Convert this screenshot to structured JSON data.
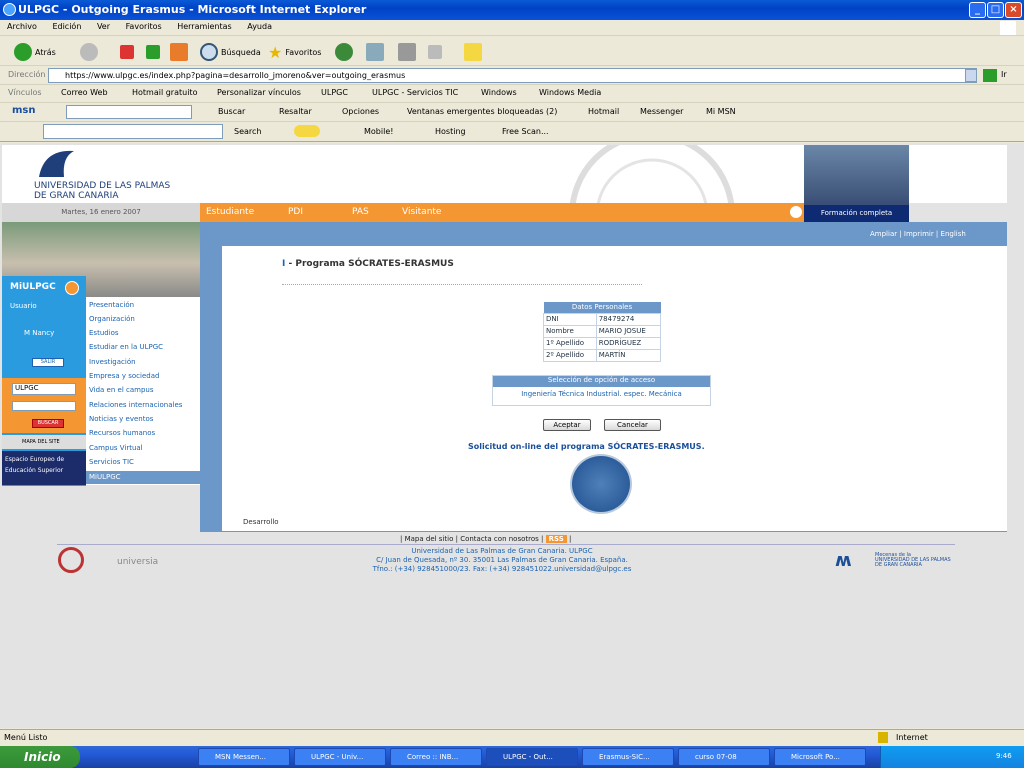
{
  "window": {
    "title": "ULPGC - Outgoing Erasmus - Microsoft Internet Explorer"
  },
  "menu": [
    "Archivo",
    "Edición",
    "Ver",
    "Favoritos",
    "Herramientas",
    "Ayuda"
  ],
  "toolbar": {
    "back": "Atrás",
    "search": "Búsqueda",
    "favorites": "Favoritos"
  },
  "address": {
    "label": "Dirección",
    "url": "https://www.ulpgc.es/index.php?pagina=desarrollo_jmoreno&ver=outgoing_erasmus",
    "go": "Ir"
  },
  "links": {
    "label": "Vínculos",
    "items": [
      "Correo Web",
      "Hotmail gratuito",
      "Personalizar vínculos",
      "ULPGC",
      "ULPGC - Servicios TIC",
      "Windows",
      "Windows Media"
    ]
  },
  "msn": {
    "brand": "msn",
    "search": "Buscar",
    "highlight": "Resaltar",
    "options": "Opciones",
    "popups": "Ventanas emergentes bloqueadas (2)",
    "hotmail": "Hotmail",
    "messenger": "Messenger",
    "mymsn": "Mi MSN"
  },
  "searchbar": {
    "search": "Search",
    "mobile": "Mobile!",
    "hosting": "Hosting",
    "freescan": "Free Scan..."
  },
  "site": {
    "logo_line1": "UNIVERSIDAD DE LAS PALMAS",
    "logo_line2": "DE GRAN CANARIA",
    "date": "Martes, 16 enero 2007",
    "nav": [
      "Estudiante",
      "PDI",
      "PAS",
      "Visitante"
    ],
    "formacion": "Formación completa",
    "toplinks": "Ampliar | Imprimir | English",
    "miulpgc": {
      "title": "MiULPGC",
      "user_label": "Usuario",
      "user": "M Nancy",
      "logout": "SALIR",
      "select": "ULPGC",
      "search_btn": "BUSCAR",
      "map": "MAPA DEL SITE",
      "espacio1": "Espacio Europeo de",
      "espacio2": "Educación Superior"
    },
    "leftmenu": [
      "Presentación",
      "Organización",
      "Estudios",
      "Estudiar en la ULPGC",
      "Investigación",
      "Empresa y sociedad",
      "Vida en el campus",
      "Relaciones internacionales",
      "Noticias y eventos",
      "Recursos humanos",
      "Campus Virtual",
      "Servicios TIC",
      "MiULPGC"
    ]
  },
  "content": {
    "heading_prefix": "I",
    "heading": " - Programa SÓCRATES-ERASMUS",
    "personal": {
      "title": "Datos Personales",
      "rows": [
        [
          "DNI",
          "78479274"
        ],
        [
          "Nombre",
          "MARIO JOSUE"
        ],
        [
          "1º Apellido",
          "RODRÍGUEZ"
        ],
        [
          "2º Apellido",
          "MARTÍN"
        ]
      ]
    },
    "selection": {
      "title": "Selección de opción de acceso",
      "value": "Ingeniería Técnica Industrial. espec. Mecánica"
    },
    "accept": "Aceptar",
    "cancel": "Cancelar",
    "solicitud": "Solicitud on-line del programa SÓCRATES-ERASMUS.",
    "desarrollo": "Desarrollo"
  },
  "footer": {
    "map": "Mapa del sitio",
    "contact": "Contacta con nosotros",
    "rss": "RSS",
    "line1": "Universidad de Las Palmas de Gran Canaria. ULPGC",
    "line2": "C/ Juan de Quesada, nº 30. 35001 Las Palmas de Gran Canaria. España.",
    "line3": "Tfno.: (+34) 928451000/23. Fax: (+34) 928451022.universidad@ulpgc.es",
    "universia": "universia",
    "mecenas1": "Mecenas de la",
    "mecenas2": "UNIVERSIDAD DE LAS PALMAS",
    "mecenas3": "DE GRAN CANARIA"
  },
  "status": {
    "left": "Menú Listo",
    "zone": "Internet"
  },
  "taskbar": {
    "start": "Inicio",
    "tasks": [
      "MSN Messen...",
      "ULPGC - Univ...",
      "Correo :: INB...",
      "ULPGC - Out...",
      "Erasmus-SIC...",
      "curso 07-08",
      "Microsoft Po..."
    ],
    "clock": "9:46"
  }
}
